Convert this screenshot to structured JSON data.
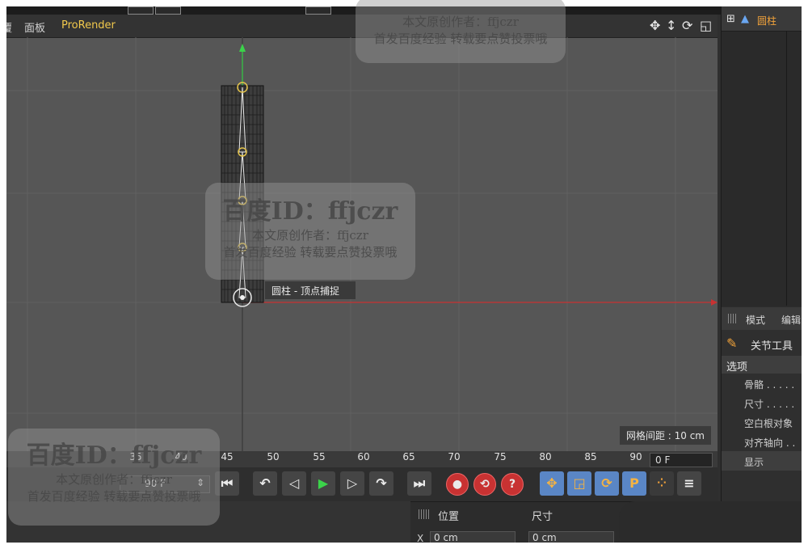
{
  "viewport_menu": {
    "item1": "覆",
    "item2": "面板",
    "item3": "ProRender"
  },
  "viewport_nav_icons": [
    "move-icon",
    "pan-icon",
    "rotate-icon",
    "maximize-icon"
  ],
  "snap_label": "圆柱 - 顶点捕捉",
  "grid_spacing": "网格间距 : 10 cm",
  "object_manager": {
    "object_name": "圆柱"
  },
  "attributes": {
    "tab_mode": "模式",
    "tab_edit": "编辑",
    "tool_name": "关节工具",
    "section": "选项",
    "props": [
      "骨骼 . . . . .",
      "尺寸 . . . . .",
      "空白根对象",
      "对齐轴向 . ."
    ],
    "bottom_tab": "显示"
  },
  "timeline": {
    "ticks": [
      "35",
      "40",
      "45",
      "50",
      "55",
      "60",
      "65",
      "70",
      "75",
      "80",
      "85",
      "90"
    ],
    "current_frame": "0 F"
  },
  "left_field": "90 F",
  "coords": {
    "pos_header": "位置",
    "size_header": "尺寸",
    "x_label": "X",
    "pos_x": "0 cm",
    "size_x": "0 cm"
  },
  "watermarks": {
    "id_line": "百度ID：ffjczr",
    "author_line": "本文原创作者：ffjczr",
    "note_line": "首发百度经验  转载要点赞投票哦"
  },
  "colors": {
    "accent_orange": "#f2a33a",
    "viewport_bg": "#565656",
    "x_axis": "#c83232",
    "y_axis": "#3bd34a"
  }
}
